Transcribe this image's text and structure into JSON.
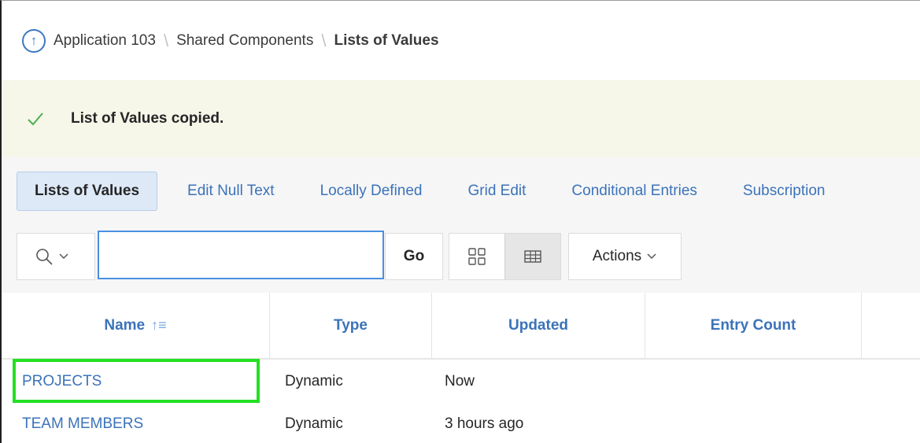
{
  "breadcrumb": {
    "items": [
      "Application 103",
      "Shared Components",
      "Lists of Values"
    ],
    "separator": "\\"
  },
  "alert": {
    "message": "List of Values copied.",
    "color": "#4caf50"
  },
  "tabs": [
    {
      "label": "Lists of Values",
      "active": true
    },
    {
      "label": "Edit Null Text"
    },
    {
      "label": "Locally Defined"
    },
    {
      "label": "Grid Edit"
    },
    {
      "label": "Conditional Entries"
    },
    {
      "label": "Subscription"
    }
  ],
  "toolbar": {
    "search_value": "",
    "go_label": "Go",
    "actions_label": "Actions"
  },
  "table": {
    "columns": [
      "Name",
      "Type",
      "Updated",
      "Entry Count"
    ],
    "rows": [
      {
        "name": "PROJECTS",
        "type": "Dynamic",
        "updated": "Now"
      },
      {
        "name": "TEAM MEMBERS",
        "type": "Dynamic",
        "updated": "3 hours ago"
      }
    ]
  },
  "colors": {
    "link": "#3b73b9",
    "highlight": "#22e022",
    "active_tab_bg": "#dde9f7"
  }
}
